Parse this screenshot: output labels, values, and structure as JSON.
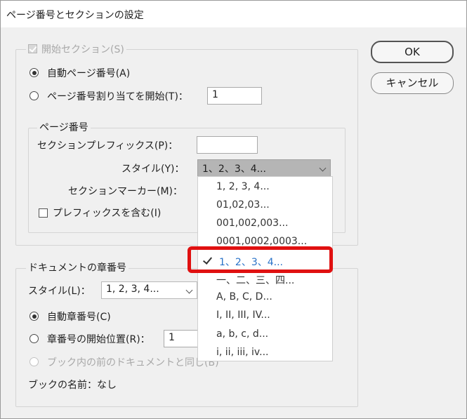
{
  "window": {
    "title": "ページ番号とセクションの設定"
  },
  "buttons": {
    "ok": "OK",
    "cancel": "キャンセル"
  },
  "section_start": {
    "label": "開始セクション(S)",
    "auto_page_number": "自動ページ番号(A)",
    "start_page_number": "ページ番号割り当てを開始(T)：",
    "start_page_value": "1"
  },
  "page_numbering": {
    "legend": "ページ番号",
    "prefix_label": "セクションプレフィックス(P)：",
    "prefix_value": "",
    "style_label": "スタイル(Y)：",
    "style_value": "1、2、3、4...",
    "marker_label": "セクションマーカー(M)：",
    "include_prefix": "プレフィックスを含む(I)"
  },
  "style_dropdown": {
    "options": [
      "1, 2, 3, 4...",
      "01,02,03...",
      "001,002,003...",
      "0001,0002,0003...",
      "1、2、3、4...",
      "一、二、三、四...",
      "A, B, C, D...",
      "I, II, III, IV...",
      "a, b, c, d...",
      "i, ii, iii, iv..."
    ],
    "selected_index": 4
  },
  "chapter": {
    "legend": "ドキュメントの章番号",
    "style_label": "スタイル(L)：",
    "style_value": "1, 2, 3, 4...",
    "auto_chapter": "自動章番号(C)",
    "start_chapter": "章番号の開始位置(R)：",
    "start_chapter_value": "1",
    "same_as_previous": "ブック内の前のドキュメントと同じ(B)",
    "book_name": "ブックの名前：なし"
  },
  "colors": {
    "highlight": "#e01010",
    "selected_option": "#2a73c8"
  }
}
